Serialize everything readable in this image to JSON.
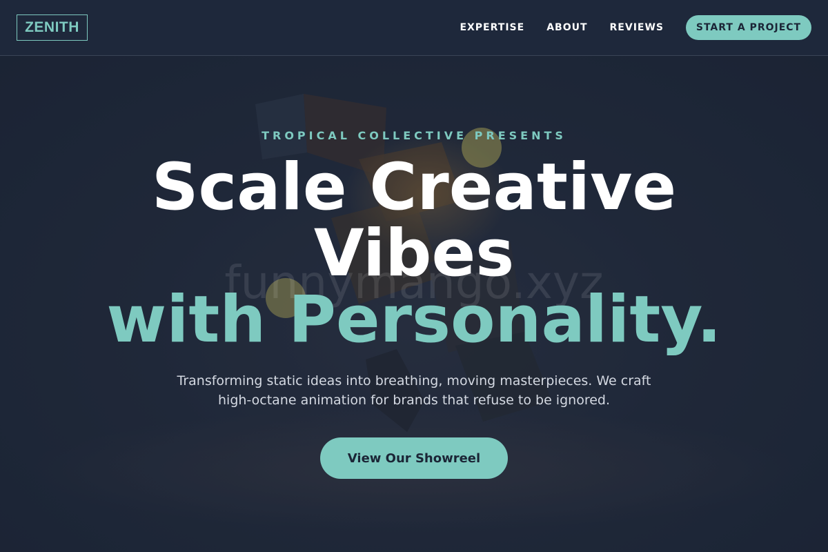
{
  "brand": {
    "logo": "ZENITH"
  },
  "nav": {
    "links": [
      "EXPERTISE",
      "ABOUT",
      "REVIEWS"
    ],
    "cta": "START A PROJECT"
  },
  "hero": {
    "eyebrow": "TROPICAL COLLECTIVE PRESENTS",
    "headline_line1": "Scale Creative",
    "headline_line2": "Vibes",
    "headline_line3": "with Personality.",
    "subtext": "Transforming static ideas into breathing, moving masterpieces. We craft high-octane animation for brands that refuse to be ignored.",
    "cta": "View Our Showreel",
    "watermark": "funnymango.xyz"
  },
  "colors": {
    "background": "#1c2536",
    "header": "#1e283b",
    "accent": "#7ecac0",
    "text": "#ffffff",
    "muted_text": "#d4d9e2"
  }
}
